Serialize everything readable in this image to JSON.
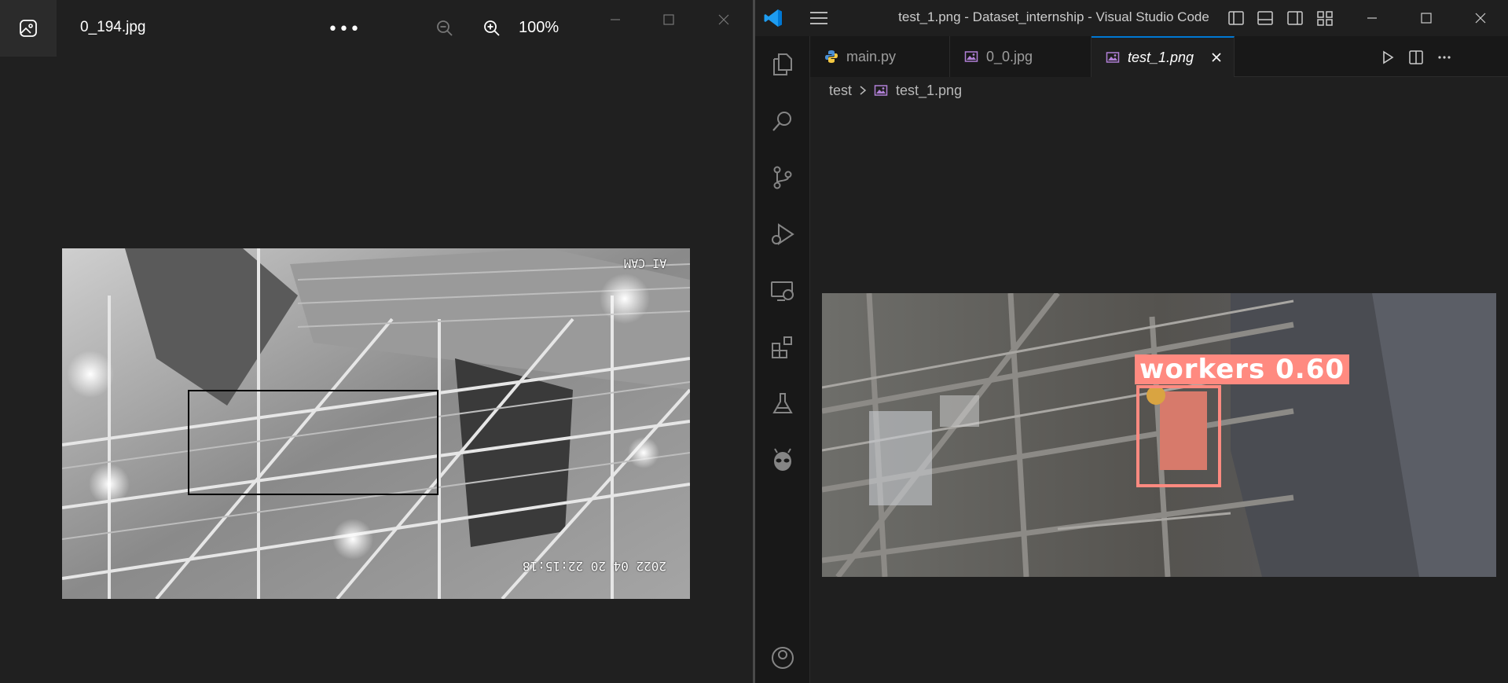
{
  "photos": {
    "filename": "0_194.jpg",
    "more_label": "•••",
    "zoom_level": "100%",
    "image": {
      "caption_top": "AI CAM",
      "caption_bottom": "2022 04 20 22:15:18"
    }
  },
  "vscode": {
    "window_title": "test_1.png - Dataset_internship - Visual Studio Code",
    "tabs": [
      {
        "label": "main.py",
        "icon": "python-icon"
      },
      {
        "label": "0_0.jpg",
        "icon": "image-icon"
      },
      {
        "label": "test_1.png",
        "icon": "image-icon",
        "active": true
      }
    ],
    "breadcrumb": {
      "folder": "test",
      "file": "test_1.png"
    },
    "image": {
      "detection_label": "workers 0.60",
      "detection_color": "#ff8a80"
    },
    "activity_bar": [
      "explorer-icon",
      "search-icon",
      "source-control-icon",
      "run-debug-icon",
      "remote-explorer-icon",
      "extensions-icon",
      "testing-icon",
      "alien-extension-icon",
      "account-icon"
    ]
  },
  "colors": {
    "photos_bg": "#202020",
    "vscode_bg": "#1f1f1f",
    "accent": "#0078d4"
  }
}
